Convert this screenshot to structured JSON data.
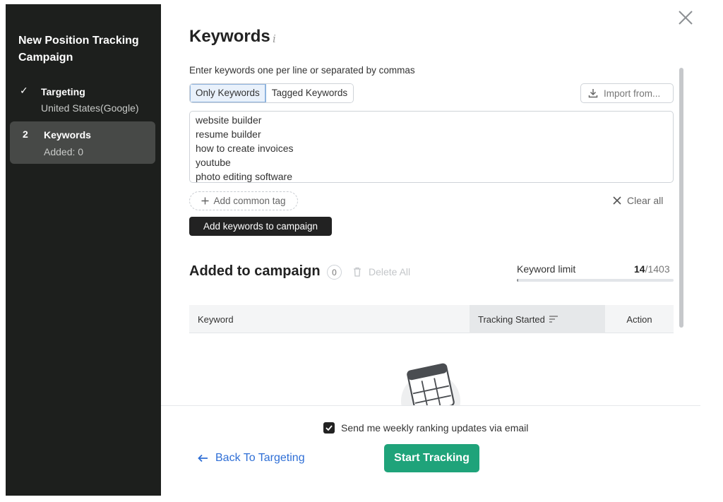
{
  "sidebar": {
    "title": "New Position Tracking Campaign",
    "steps": [
      {
        "mark": "✓",
        "name": "Targeting",
        "sub": "United States(Google)"
      },
      {
        "mark": "2",
        "name": "Keywords",
        "sub": "Added: 0"
      }
    ]
  },
  "main": {
    "title": "Keywords",
    "info_icon": "i",
    "instructions": "Enter keywords one per line or separated by commas",
    "tabs": [
      "Only Keywords",
      "Tagged Keywords"
    ],
    "import_label": "Import from...",
    "keywords": [
      "website builder",
      "resume builder",
      "how to create invoices",
      "youtube",
      "photo editing software"
    ],
    "add_tag_label": "Add common tag",
    "clear_all_label": "Clear all",
    "add_button_label": "Add keywords to campaign"
  },
  "added": {
    "title": "Added to campaign",
    "count": "0",
    "delete_all_label": "Delete All",
    "limit_label": "Keyword limit",
    "limit_used": "14",
    "limit_total": "/1403",
    "limit_fraction": 0.01,
    "columns": [
      "Keyword",
      "Tracking Started",
      "Action"
    ]
  },
  "footer": {
    "checkbox_label": "Send me weekly ranking updates via email",
    "checkbox_checked": true,
    "back_label": "Back To Targeting",
    "start_label": "Start Tracking"
  },
  "colors": {
    "sidebar_bg": "#1d1f1d",
    "active_step_bg": "#474947",
    "primary_green": "#1fa37a",
    "link_blue": "#2f6fd6"
  },
  "icons": [
    "check-icon",
    "info-icon",
    "close-icon",
    "download-icon",
    "plus-icon",
    "x-icon",
    "trash-icon",
    "sort-icon",
    "calendar-illustration",
    "arrow-left-icon",
    "checkbox-check-icon"
  ]
}
